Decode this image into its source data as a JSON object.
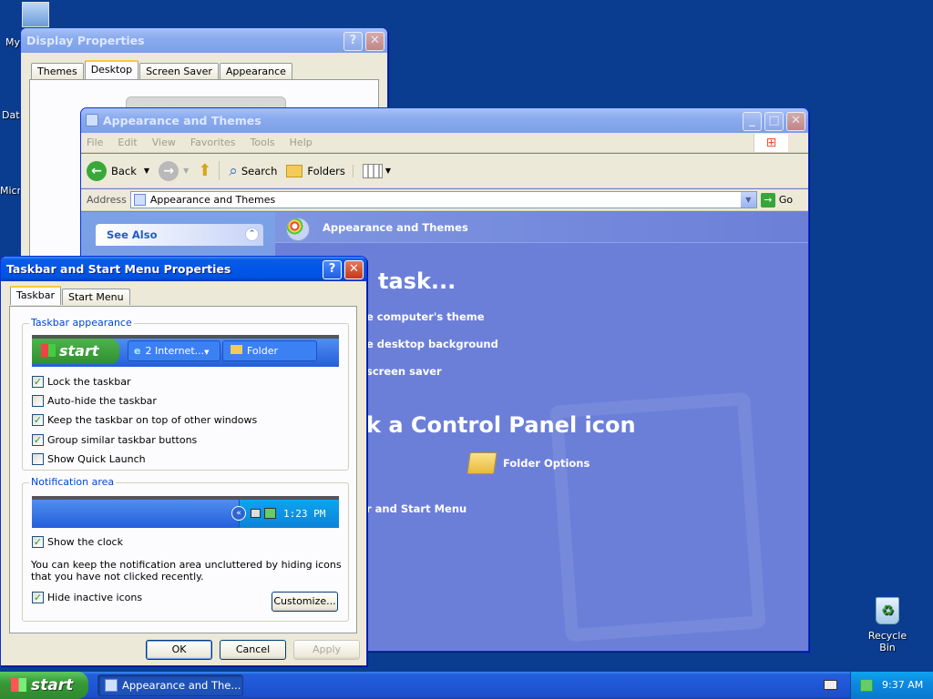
{
  "desktop": {
    "icons": [
      {
        "label": "My",
        "icon": "my-computer-icon"
      },
      {
        "label": "Dat",
        "icon": "document-icon"
      },
      {
        "label": "Micro",
        "icon": "app-icon"
      },
      {
        "label": "Recycle Bin",
        "icon": "recycle-bin-icon"
      }
    ]
  },
  "display_properties": {
    "title": "Display Properties",
    "tabs": [
      "Themes",
      "Desktop",
      "Screen Saver",
      "Appearance"
    ],
    "active_tab": "Desktop"
  },
  "explorer": {
    "title": "Appearance and Themes",
    "menu": [
      "File",
      "Edit",
      "View",
      "Favorites",
      "Tools",
      "Help"
    ],
    "toolbar": {
      "back": "Back",
      "search": "Search",
      "folders": "Folders"
    },
    "address_label": "Address",
    "address_value": "Appearance and Themes",
    "go_label": "Go",
    "see_also": "See Also",
    "header": "Appearance and Themes",
    "pick_task": "task...",
    "tasks": [
      "e computer's theme",
      "e desktop background",
      "screen saver"
    ],
    "pick_icon": "k a Control Panel icon",
    "folder_options": "Folder Options",
    "taskbar_item": "r and Start Menu"
  },
  "taskbar_props": {
    "title": "Taskbar and Start Menu Properties",
    "tabs": [
      "Taskbar",
      "Start Menu"
    ],
    "appearance_group": "Taskbar appearance",
    "preview": {
      "start": "start",
      "item1": "2 Internet...",
      "item2": "Folder"
    },
    "options": [
      {
        "label": "Lock the taskbar",
        "checked": true
      },
      {
        "label": "Auto-hide the taskbar",
        "checked": false
      },
      {
        "label": "Keep the taskbar on top of other windows",
        "checked": true
      },
      {
        "label": "Group similar taskbar buttons",
        "checked": true
      },
      {
        "label": "Show Quick Launch",
        "checked": false
      }
    ],
    "notification_group": "Notification area",
    "notif_time": "1:23 PM",
    "show_clock": {
      "label": "Show the clock",
      "checked": true
    },
    "notif_desc": "You can keep the notification area uncluttered by hiding icons that you have not clicked recently.",
    "hide_inactive": {
      "label": "Hide inactive icons",
      "checked": true
    },
    "customize": "Customize...",
    "ok": "OK",
    "cancel": "Cancel",
    "apply": "Apply"
  },
  "taskbar": {
    "start": "start",
    "window_button": "Appearance and The...",
    "clock": "9:37 AM"
  },
  "colors": {
    "xp_blue": "#0a3d8f",
    "title_active": "#0058e6",
    "task_panel": "#6c7fd8"
  }
}
